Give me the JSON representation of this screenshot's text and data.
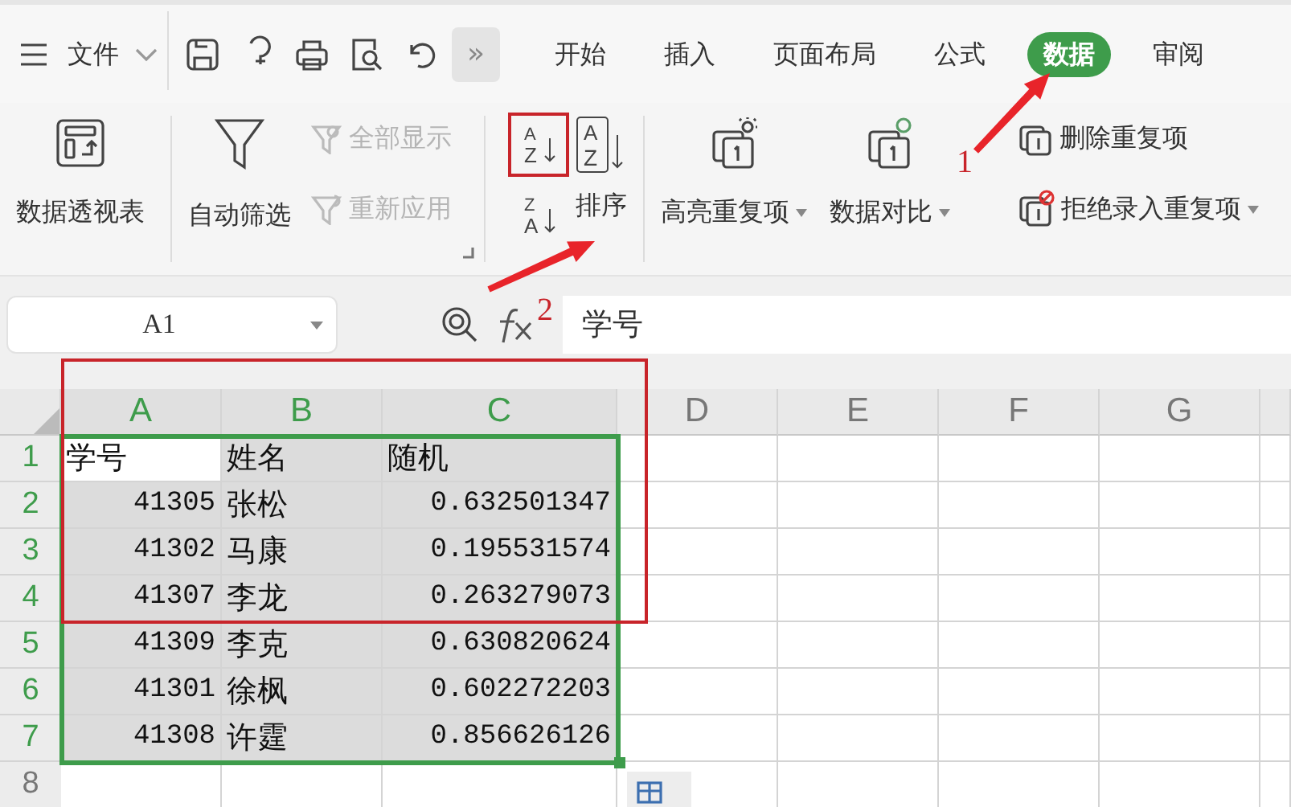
{
  "menu": {
    "label": "文件"
  },
  "more_button": {
    "label": "»"
  },
  "tabs": [
    {
      "label": "开始",
      "selected": false
    },
    {
      "label": "插入",
      "selected": false
    },
    {
      "label": "页面布局",
      "selected": false
    },
    {
      "label": "公式",
      "selected": false
    },
    {
      "label": "数据",
      "selected": true
    },
    {
      "label": "审阅",
      "selected": false
    }
  ],
  "ribbon": [
    {
      "kind": "large",
      "label": "数据透视表",
      "dropdown": false
    },
    {
      "kind": "large",
      "label": "自动筛选",
      "dropdown": false
    },
    {
      "kind": "stack",
      "items": [
        {
          "label": "全部显示",
          "dropdown": false,
          "disabled": true
        },
        {
          "label": "重新应用",
          "dropdown": false,
          "disabled": true
        }
      ]
    },
    {
      "kind": "sort",
      "ascending": {
        "top": "A",
        "bottom": "Z"
      },
      "descending": {
        "top": "Z",
        "bottom": "A"
      },
      "label": "排序",
      "large_icon": {
        "top": "A",
        "bottom": "Z"
      }
    },
    {
      "kind": "large",
      "label": "高亮重复项",
      "dropdown": true
    },
    {
      "kind": "large",
      "label": "数据对比",
      "dropdown": true,
      "callout": "1"
    },
    {
      "kind": "stack",
      "items": [
        {
          "label": "删除重复项",
          "dropdown": false,
          "disabled": false
        },
        {
          "label": "拒绝录入重复项",
          "dropdown": true,
          "disabled": false
        }
      ]
    }
  ],
  "name_box": {
    "value": "A1"
  },
  "formula_bar": {
    "callout": "2",
    "value": "学号"
  },
  "sheet": {
    "columns": [
      {
        "label": "A",
        "selected": true
      },
      {
        "label": "B",
        "selected": true
      },
      {
        "label": "C",
        "selected": true
      },
      {
        "label": "D",
        "selected": false
      },
      {
        "label": "E",
        "selected": false
      },
      {
        "label": "F",
        "selected": false
      },
      {
        "label": "G",
        "selected": false
      }
    ],
    "rows": [
      {
        "label": "1",
        "selected": true,
        "kind": "header",
        "cells": [
          {
            "text": "学号",
            "active": true
          },
          {
            "text": "姓名",
            "active": false
          },
          {
            "text": "随机",
            "active": false
          }
        ]
      },
      {
        "label": "2",
        "selected": true,
        "kind": "data",
        "cells": [
          {
            "text": "41305",
            "active": false
          },
          {
            "text": "张松",
            "active": false
          },
          {
            "text": "0.632501347",
            "active": false
          }
        ]
      },
      {
        "label": "3",
        "selected": true,
        "kind": "data",
        "cells": [
          {
            "text": "41302",
            "active": false
          },
          {
            "text": "马康",
            "active": false
          },
          {
            "text": "0.195531574",
            "active": false
          }
        ]
      },
      {
        "label": "4",
        "selected": true,
        "kind": "data",
        "cells": [
          {
            "text": "41307",
            "active": false
          },
          {
            "text": "李龙",
            "active": false
          },
          {
            "text": "0.263279073",
            "active": false
          }
        ]
      },
      {
        "label": "5",
        "selected": true,
        "kind": "data",
        "cells": [
          {
            "text": "41309",
            "active": false
          },
          {
            "text": "李克",
            "active": false
          },
          {
            "text": "0.630820624",
            "active": false
          }
        ]
      },
      {
        "label": "6",
        "selected": true,
        "kind": "data",
        "cells": [
          {
            "text": "41301",
            "active": false
          },
          {
            "text": "徐枫",
            "active": false
          },
          {
            "text": "0.602272203",
            "active": false
          }
        ]
      },
      {
        "label": "7",
        "selected": true,
        "kind": "data",
        "cells": [
          {
            "text": "41308",
            "active": false
          },
          {
            "text": "许霆",
            "active": false
          },
          {
            "text": "0.856626126",
            "active": false
          }
        ]
      },
      {
        "label": "8",
        "selected": false,
        "cells": []
      }
    ]
  }
}
